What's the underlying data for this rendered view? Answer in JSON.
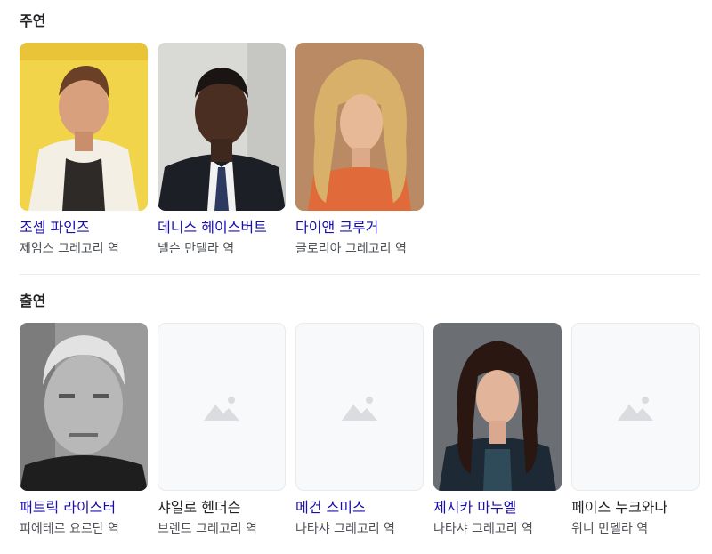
{
  "sections": [
    {
      "title": "주연",
      "cast": [
        {
          "name": "조셉 파인즈",
          "role": "제임스 그레고리 역",
          "photo": "actor-photo",
          "linked": true
        },
        {
          "name": "데니스 헤이스버트",
          "role": "넬슨 만델라 역",
          "photo": "actor-photo",
          "linked": true
        },
        {
          "name": "다이앤 크루거",
          "role": "글로리아 그레고리 역",
          "photo": "actor-photo",
          "linked": true
        }
      ]
    },
    {
      "title": "출연",
      "cast": [
        {
          "name": "패트릭 라이스터",
          "role": "피에테르 요르단 역",
          "photo": "actor-photo",
          "linked": true
        },
        {
          "name": "샤일로 헨더슨",
          "role": "브렌트 그레고리 역",
          "photo": "placeholder-image-icon",
          "linked": false
        },
        {
          "name": "메건 스미스",
          "role": "나타샤 그레고리 역",
          "photo": "placeholder-image-icon",
          "linked": true
        },
        {
          "name": "제시카 마누엘",
          "role": "나타샤 그레고리 역",
          "photo": "actor-photo",
          "linked": true
        },
        {
          "name": "페이스 누크와나",
          "role": "위니 만델라 역",
          "photo": "placeholder-image-icon",
          "linked": false
        }
      ]
    }
  ],
  "colors": {
    "link": "#1a0dab",
    "text": "#202124",
    "subtext": "#4d5156",
    "placeholder_icon": "#dadce0"
  }
}
